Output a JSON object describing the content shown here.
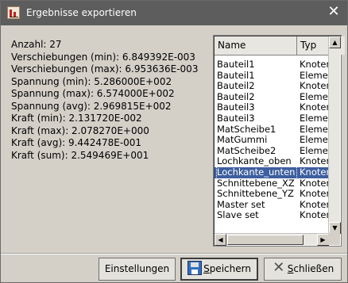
{
  "window": {
    "title": "Ergebnisse exportieren",
    "close_glyph": "✕",
    "app_icon": "chart-icon"
  },
  "stats": [
    "Anzahl: 27",
    "Verschiebungen (min): 6.849392E-003",
    "Verschiebungen (max): 6.953636E-003",
    "Spannung (min): 5.286000E+002",
    "Spannung (max): 6.574000E+002",
    "Spannung (avg): 2.969815E+002",
    "Kraft (min): 2.131720E-002",
    "Kraft (max): 2.078270E+000",
    "Kraft (avg): 9.442478E-001",
    "Kraft (sum): 2.549469E+001"
  ],
  "list": {
    "columns": [
      "Name",
      "Typ"
    ],
    "rows": [
      {
        "name": "Bauteil1",
        "typ": "Knoten"
      },
      {
        "name": "Bauteil1",
        "typ": "Element"
      },
      {
        "name": "Bauteil2",
        "typ": "Knoten"
      },
      {
        "name": "Bauteil2",
        "typ": "Element"
      },
      {
        "name": "Bauteil3",
        "typ": "Knoten"
      },
      {
        "name": "Bauteil3",
        "typ": "Element"
      },
      {
        "name": "MatScheibe1",
        "typ": "Element"
      },
      {
        "name": "MatGummi",
        "typ": "Element"
      },
      {
        "name": "MatScheibe2",
        "typ": "Element"
      },
      {
        "name": "Lochkante_oben",
        "typ": "Knoten"
      },
      {
        "name": "Lochkante_unten",
        "typ": "Knoten",
        "selected": true
      },
      {
        "name": "Schnittebene_XZ",
        "typ": "Knoten"
      },
      {
        "name": "Schnittebene_YZ",
        "typ": "Knoten"
      },
      {
        "name": "Master set",
        "typ": "Knoten"
      },
      {
        "name": "Slave set",
        "typ": "Knoten"
      }
    ],
    "selected_color": "#3d5f9f"
  },
  "buttons": {
    "settings": "Einstellungen",
    "save_mnemonic": "S",
    "save_rest": "peichern",
    "close_mnemonic": "S",
    "close_rest": "chließen"
  }
}
